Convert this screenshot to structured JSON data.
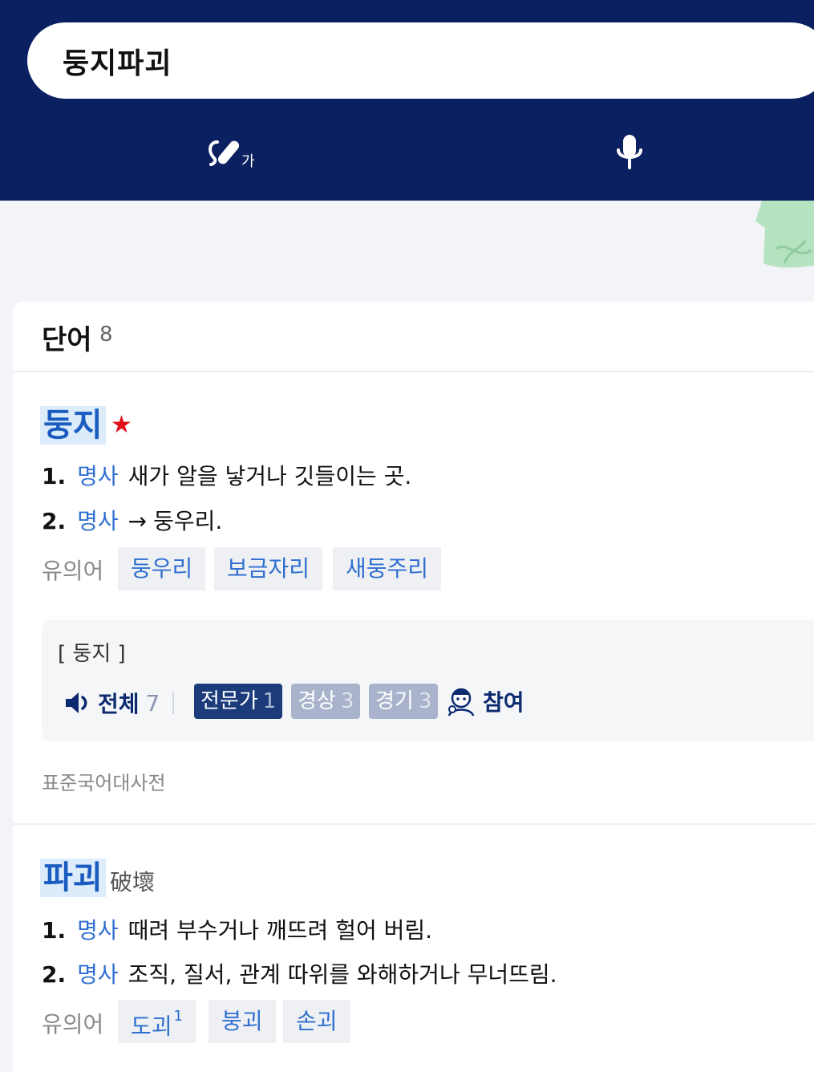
{
  "search": {
    "query": "둥지파괴"
  },
  "toolbar": {
    "handwriting_icon": "handwriting-icon",
    "voice_icon": "microphone-icon",
    "handwriting_glyph": "가"
  },
  "colors": {
    "header_bg": "#0b2060",
    "highlight": "#dcecfb",
    "link": "#2f6fd0",
    "star": "#e0101a"
  },
  "section": {
    "title": "단어",
    "count": "8"
  },
  "entries": [
    {
      "word": "둥지",
      "starred": true,
      "senses": [
        {
          "num": "1.",
          "pos": "명사",
          "text": "새가 알을 낳거나 깃들이는 곳."
        },
        {
          "num": "2.",
          "pos": "명사",
          "arrow": "→",
          "text": "둥우리."
        }
      ],
      "synonym_label": "유의어",
      "synonyms": [
        "둥우리",
        "보금자리",
        "새둥주리"
      ],
      "pronunciation": {
        "word": "[ 둥지 ]",
        "all_label": "전체",
        "all_count": "7",
        "chips": [
          {
            "label": "전문가",
            "count": "1"
          },
          {
            "label": "경상",
            "count": "3"
          },
          {
            "label": "경기",
            "count": "3"
          }
        ],
        "join_label": "참여"
      },
      "source": "표준국어대사전"
    },
    {
      "word": "파괴",
      "hanja": "破壞",
      "senses": [
        {
          "num": "1.",
          "pos": "명사",
          "text": "때려 부수거나 깨뜨려 헐어 버림."
        },
        {
          "num": "2.",
          "pos": "명사",
          "text": "조직, 질서, 관계 따위를 와해하거나 무너뜨림."
        }
      ],
      "synonym_label": "유의어",
      "synonyms": [
        {
          "text": "도괴",
          "sup": "1"
        },
        {
          "text": "붕괴"
        },
        {
          "text": "손괴"
        }
      ]
    }
  ]
}
